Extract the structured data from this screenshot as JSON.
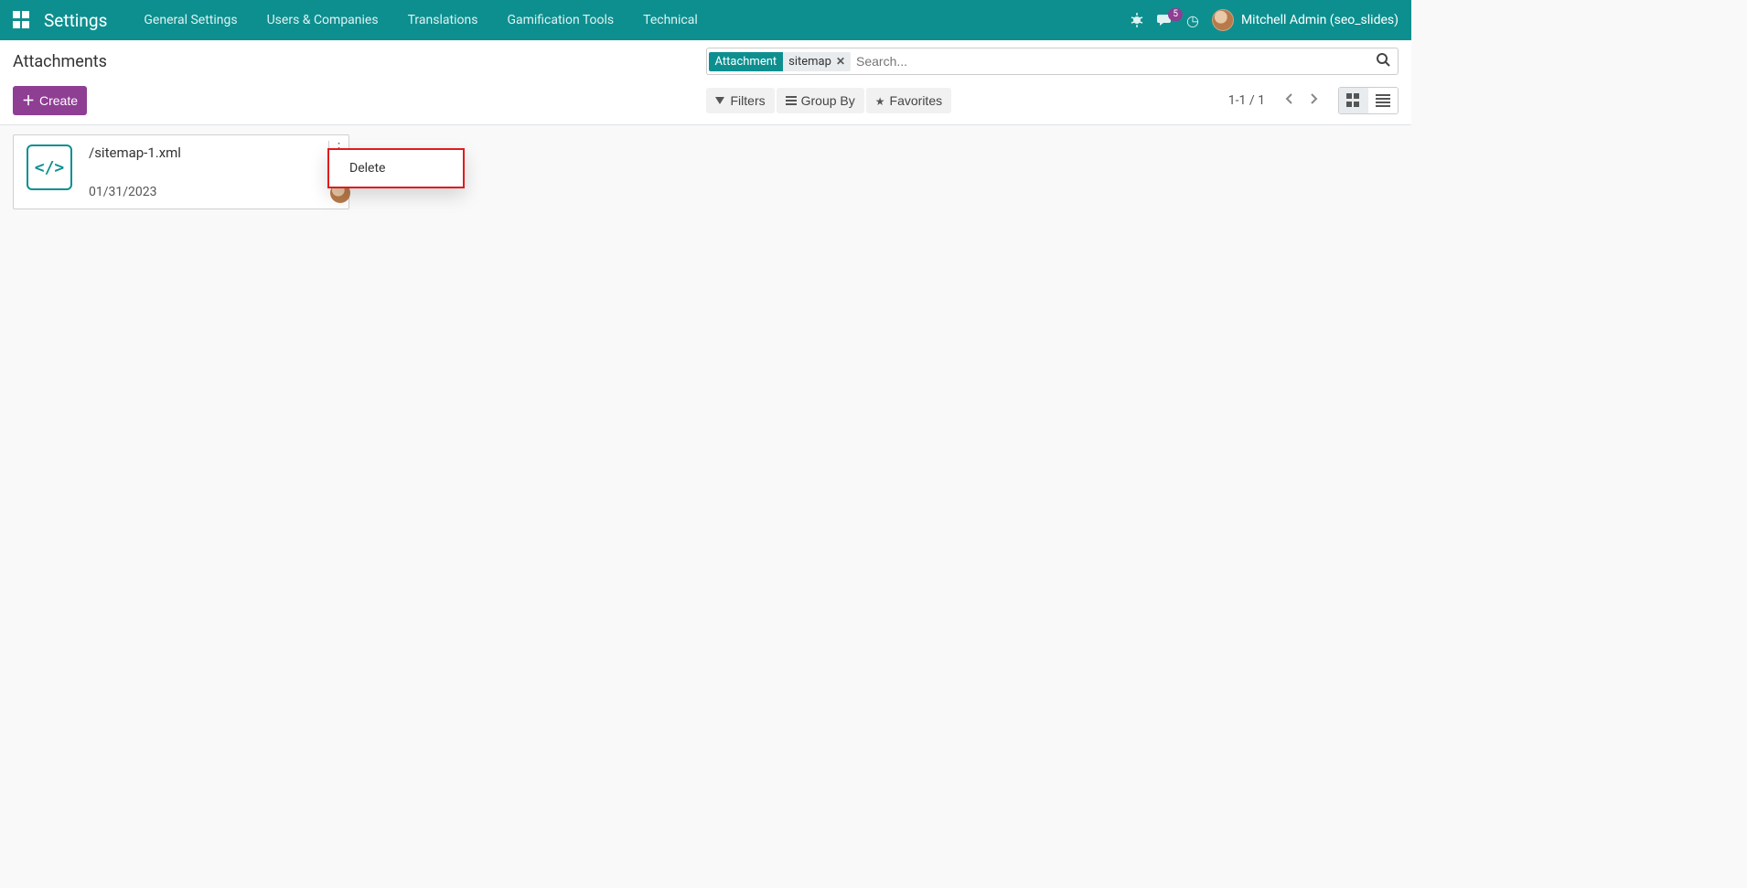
{
  "nav": {
    "brand": "Settings",
    "menu": [
      "General Settings",
      "Users & Companies",
      "Translations",
      "Gamification Tools",
      "Technical"
    ],
    "messages_badge": "5",
    "user": "Mitchell Admin (seo_slides)"
  },
  "control": {
    "title": "Attachments",
    "create_label": "Create",
    "search": {
      "facet_label": "Attachment",
      "facet_value": "sitemap",
      "placeholder": "Search..."
    },
    "filters_label": "Filters",
    "groupby_label": "Group By",
    "favorites_label": "Favorites",
    "pager": "1-1 / 1"
  },
  "card": {
    "title": "/sitemap-1.xml",
    "date": "01/31/2023"
  },
  "dropdown": {
    "delete": "Delete"
  }
}
